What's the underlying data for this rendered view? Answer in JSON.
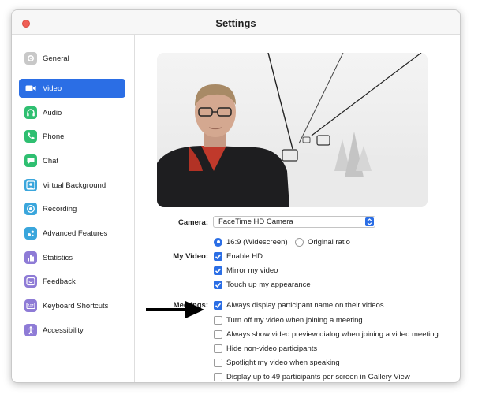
{
  "window": {
    "title": "Settings"
  },
  "sidebar": {
    "items": [
      {
        "label": "General",
        "icon": "gear-icon",
        "color": "#c8c8c8",
        "active": false
      },
      {
        "label": "Video",
        "icon": "video-camera-icon",
        "color": "#2b6ee5",
        "active": true
      },
      {
        "label": "Audio",
        "icon": "headphones-icon",
        "color": "#2fbf71",
        "active": false
      },
      {
        "label": "Phone",
        "icon": "phone-icon",
        "color": "#2fbf71",
        "active": false
      },
      {
        "label": "Chat",
        "icon": "chat-bubble-icon",
        "color": "#2fbf71",
        "active": false
      },
      {
        "label": "Virtual Background",
        "icon": "person-background-icon",
        "color": "#3aa6dc",
        "active": false
      },
      {
        "label": "Recording",
        "icon": "record-icon",
        "color": "#3aa6dc",
        "active": false
      },
      {
        "label": "Advanced Features",
        "icon": "sparkle-icon",
        "color": "#3aa6dc",
        "active": false
      },
      {
        "label": "Statistics",
        "icon": "bar-chart-icon",
        "color": "#8e7bd6",
        "active": false
      },
      {
        "label": "Feedback",
        "icon": "smiley-icon",
        "color": "#8e7bd6",
        "active": false
      },
      {
        "label": "Keyboard Shortcuts",
        "icon": "keyboard-icon",
        "color": "#8e7bd6",
        "active": false
      },
      {
        "label": "Accessibility",
        "icon": "accessibility-person-icon",
        "color": "#8e7bd6",
        "active": false
      }
    ]
  },
  "camera": {
    "label": "Camera:",
    "value": "FaceTime HD Camera"
  },
  "aspect": {
    "widescreen": {
      "label": "16:9 (Widescreen)",
      "selected": true
    },
    "original": {
      "label": "Original ratio",
      "selected": false
    }
  },
  "my_video": {
    "label": "My Video:",
    "options": [
      {
        "label": "Enable HD",
        "checked": true
      },
      {
        "label": "Mirror my video",
        "checked": true
      },
      {
        "label": "Touch up my appearance",
        "checked": true
      }
    ]
  },
  "meetings": {
    "label": "Meetings:",
    "options": [
      {
        "label": "Always display participant name on their videos",
        "checked": true
      },
      {
        "label": "Turn off my video when joining a meeting",
        "checked": false
      },
      {
        "label": "Always show video preview dialog when joining a video meeting",
        "checked": false
      },
      {
        "label": "Hide non-video participants",
        "checked": false
      },
      {
        "label": "Spotlight my video when speaking",
        "checked": false
      },
      {
        "label": "Display up to 49 participants per screen in Gallery View",
        "checked": false
      }
    ]
  },
  "colors": {
    "accent": "#2b6ee5",
    "close": "#ef5f56"
  }
}
